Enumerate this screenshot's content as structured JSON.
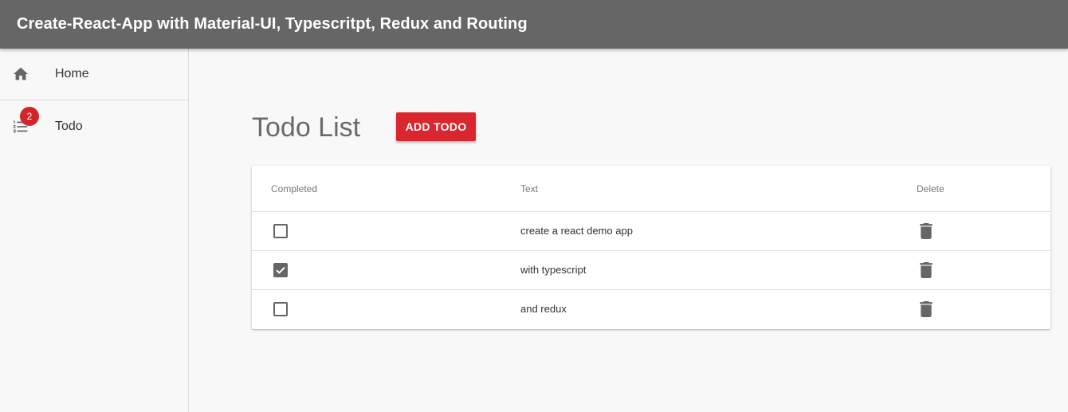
{
  "appbar": {
    "title": "Create-React-App with Material-UI, Typescritpt, Redux and Routing"
  },
  "drawer": {
    "items": [
      {
        "label": "Home",
        "icon": "home-icon"
      },
      {
        "label": "Todo",
        "icon": "format-list-numbered-icon",
        "badge": "2"
      }
    ]
  },
  "main": {
    "title": "Todo List",
    "add_button": "ADD TODO",
    "table": {
      "columns": [
        "Completed",
        "Text",
        "Delete"
      ],
      "rows": [
        {
          "completed": false,
          "text": "create a react demo app",
          "delete_icon": "trash-icon"
        },
        {
          "completed": true,
          "text": "with typescript",
          "delete_icon": "trash-icon"
        },
        {
          "completed": false,
          "text": "and redux",
          "delete_icon": "trash-icon"
        }
      ]
    }
  },
  "colors": {
    "appbar": "#666666",
    "accent": "#d9262f",
    "background": "#f8f8f8"
  }
}
